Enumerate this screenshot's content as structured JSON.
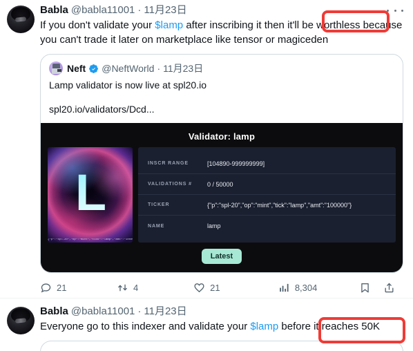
{
  "app": {
    "platform": "twitter"
  },
  "tweet1": {
    "author": {
      "display_name": "Babla",
      "handle": "@babla11001",
      "separator": "·",
      "date": "11月23日"
    },
    "avatar_name": "babla-avatar",
    "text_part1": "If you don't validate your ",
    "cashtag": "$lamp",
    "text_part2": " after inscribing it then it'll be worthless because you can't trade it later on marketplace like tensor or magiceden",
    "more_menu_label": "More",
    "quote": {
      "author": {
        "display_name": "Neft",
        "handle": "@NeftWorld",
        "separator": "·",
        "date": "11月23日"
      },
      "verified": true,
      "line1": "Lamp validator is now live at spl20.io",
      "line2": "spl20.io/validators/Dcd...",
      "card": {
        "title": "Validator: lamp",
        "thumb_caption": "{\"p\":\"spl-20\",\"op\":\"mint\",\"tick\":\"lamp\",\"amt\":\"100000\"}",
        "thumb_letter": "L",
        "rows": [
          {
            "label": "INSCR RANGE",
            "value": "[104890-999999999]"
          },
          {
            "label": "VALIDATIONS #",
            "value": "0 / 50000"
          },
          {
            "label": "TICKER",
            "value": "{\"p\":\"spl-20\",\"op\":\"mint\",\"tick\":\"lamp\",\"amt\":\"100000\"}"
          },
          {
            "label": "NAME",
            "value": "lamp"
          }
        ],
        "badge": "Latest"
      }
    },
    "actions": {
      "reply_count": "21",
      "retweet_count": "4",
      "like_count": "21",
      "view_count": "8,304",
      "bookmark_label": "Bookmark",
      "share_label": "Share"
    }
  },
  "tweet2": {
    "author": {
      "display_name": "Babla",
      "handle": "@babla11001",
      "separator": "·",
      "date": "11月23日"
    },
    "avatar_name": "babla-avatar",
    "text_part1": "Everyone go to this indexer and validate your ",
    "cashtag": "$lamp",
    "text_part2": " before it reaches 50K"
  },
  "annotations": {
    "box1_text": "be worthless",
    "box2_text": "it reaches 50K",
    "color": "#ef3b36"
  },
  "colors": {
    "link": "#1d9bf0",
    "verified": "#1d9bf0",
    "badge_bg": "#a7e8d4",
    "card_bg": "#0c0c0e",
    "table_bg": "#1b2030"
  }
}
